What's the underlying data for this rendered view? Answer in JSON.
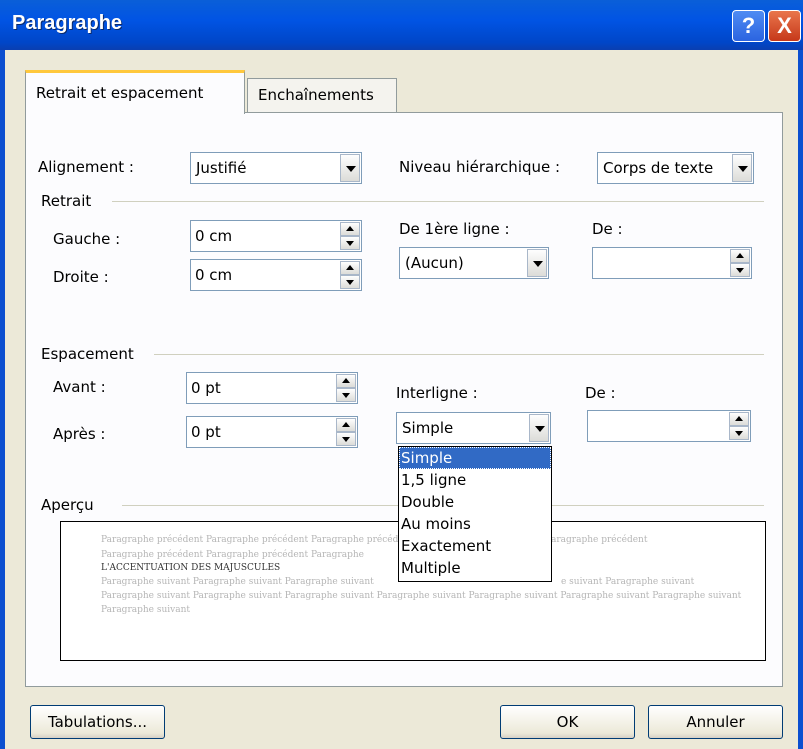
{
  "window": {
    "title": "Paragraphe",
    "help_glyph": "?",
    "close_glyph": "X"
  },
  "tabs": [
    {
      "label": "Retrait et espacement",
      "active": true
    },
    {
      "label": "Enchaînements",
      "active": false
    }
  ],
  "alignment": {
    "label": "Alignement :",
    "value": "Justifié"
  },
  "outline_level": {
    "label": "Niveau hiérarchique :",
    "value": "Corps de texte"
  },
  "indent": {
    "section": "Retrait",
    "left_label": "Gauche :",
    "left_value": "0 cm",
    "right_label": "Droite :",
    "right_value": "0 cm",
    "first_line_label": "De 1ère ligne :",
    "first_line_value": "(Aucun)",
    "by_label": "De :",
    "by_value": ""
  },
  "spacing": {
    "section": "Espacement",
    "before_label": "Avant :",
    "before_value": "0 pt",
    "after_label": "Après :",
    "after_value": "0 pt",
    "line_label": "Interligne :",
    "line_value": "Simple",
    "at_label": "De :",
    "at_value": "",
    "line_options": [
      "Simple",
      "1,5 ligne",
      "Double",
      "Au moins",
      "Exactement",
      "Multiple"
    ],
    "selected_option": "Simple"
  },
  "preview": {
    "section": "Aperçu",
    "prev1": "Paragraphe précédent Paragraphe précédent Paragraphe précédent",
    "prev1b": "aragraphe précédent",
    "prev2": "Paragraphe précédent Paragraphe précédent Paragraphe",
    "current": "L'ACCENTUATION DES MAJUSCULES",
    "next1": "Paragraphe suivant Paragraphe suivant Paragraphe suivant",
    "next1b": "e suivant Paragraphe suivant",
    "next2": "Paragraphe suivant Paragraphe suivant Paragraphe suivant Paragraphe suivant Paragraphe suivant Paragraphe suivant Paragraphe suivant",
    "next3": "Paragraphe suivant"
  },
  "buttons": {
    "tabs": "Tabulations...",
    "ok": "OK",
    "cancel": "Annuler"
  },
  "colors": {
    "title_bar": "#0054e3",
    "selection": "#316ac5",
    "tab_highlight": "#ffc83c"
  }
}
